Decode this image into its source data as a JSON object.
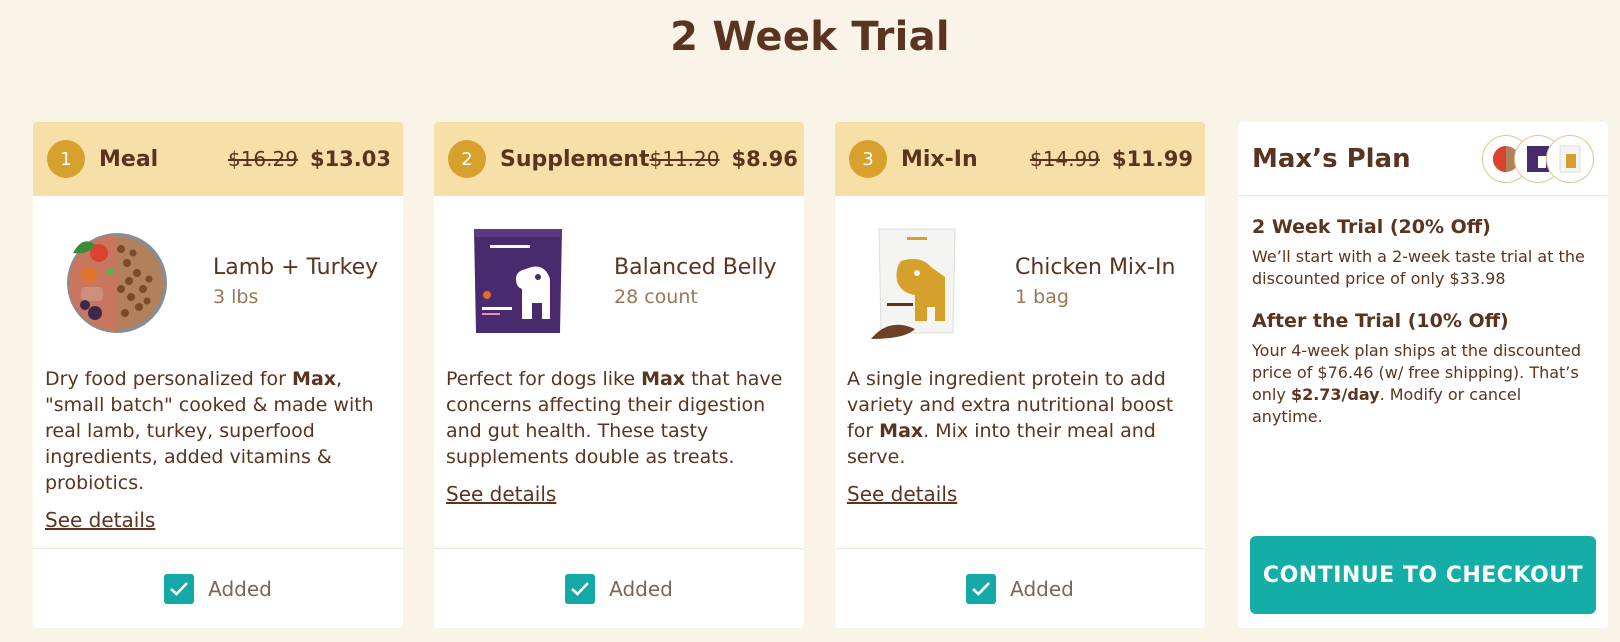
{
  "page_title": "2 Week Trial",
  "cards": [
    {
      "step": "1",
      "title": "Meal",
      "price_old": "$16.29",
      "price_new": "$13.03",
      "product_name": "Lamb + Turkey",
      "product_qty": "3 lbs",
      "desc_before": "Dry food personalized for ",
      "desc_name": "Max",
      "desc_after": ", \"small batch\" cooked & made with real lamb, turkey, superfood ingredients, added vitamins & probiotics.",
      "see_details": "See details",
      "added_label": "Added",
      "image_icon": "food-bowl-icon"
    },
    {
      "step": "2",
      "title": "Supplement",
      "price_old": "$11.20",
      "price_new": "$8.96",
      "product_name": "Balanced Belly",
      "product_qty": "28 count",
      "desc_before": "Perfect for dogs like ",
      "desc_name": "Max",
      "desc_after": " that have concerns affecting their digestion and gut health. These tasty supplements double as treats.",
      "see_details": "See details",
      "added_label": "Added",
      "image_icon": "supplement-bag-icon"
    },
    {
      "step": "3",
      "title": "Mix-In",
      "price_old": "$14.99",
      "price_new": "$11.99",
      "product_name": "Chicken Mix-In",
      "product_qty": "1 bag",
      "desc_before": "A single ingredient protein to add variety and extra nutritional boost for ",
      "desc_name": "Max",
      "desc_after": ". Mix into their meal and serve.",
      "see_details": "See details",
      "added_label": "Added",
      "image_icon": "mixin-bag-icon"
    }
  ],
  "plan": {
    "title": "Max’s Plan",
    "trial_title": "2 Week Trial (20% Off)",
    "trial_text": "We’ll start with a 2-week taste trial at the discounted price of only $33.98",
    "after_title": "After the Trial (10% Off)",
    "after_text_before": "Your 4-week plan ships at the discounted price of $76.46 (w/ free shipping). That’s only ",
    "after_text_bold": "$2.73/day",
    "after_text_after": ". Modify or cancel anytime.",
    "checkout_label": "CONTINUE TO CHECKOUT"
  },
  "colors": {
    "background": "#f9f4e7",
    "header_band": "#f7e0a8",
    "step_badge": "#d8a02c",
    "accent_teal": "#14aea7",
    "text_brown": "#5a3420"
  }
}
